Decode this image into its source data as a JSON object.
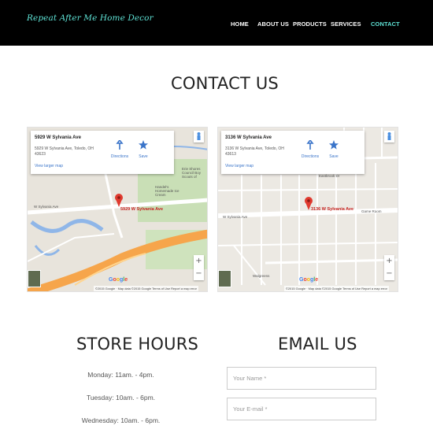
{
  "brand": "Repeat After Me Home Decor",
  "nav": [
    {
      "label": "HOME",
      "active": false
    },
    {
      "label": "ABOUT US",
      "active": false
    },
    {
      "label": "PRODUCTS",
      "active": false
    },
    {
      "label": "SERVICES",
      "active": false
    },
    {
      "label": "CONTACT",
      "active": true
    }
  ],
  "contact_title": "CONTACT US",
  "maps": [
    {
      "title": "5929 W Sylvania Ave",
      "address": "5929 W Sylvania Ave, Toledo, OH 43623",
      "link": "View larger map",
      "directions": "Directions",
      "save": "Save",
      "pin_label": "5929 W Sylvania Ave",
      "road": "W Sylvania Ave",
      "places": [
        "Handel's Homemade Ice Cream",
        "Erie Shores Council Boy Scouts of"
      ],
      "attribution": "©2015 Google · Map data ©2015 Google   Terms of Use   Report a map error"
    },
    {
      "title": "3136 W Sylvania Ave",
      "address": "3136 W Sylvania Ave, Toledo, OH 43613",
      "link": "View larger map",
      "directions": "Directions",
      "save": "Save",
      "pin_label": "3136 W Sylvania Ave",
      "road": "W Sylvania Ave",
      "places": [
        "Eastbrook Dr",
        "Game Room",
        "Walgreens"
      ],
      "attribution": "©2015 Google · Map data ©2015 Google   Terms of Use   Report a map error"
    }
  ],
  "store_hours_title": "STORE HOURS",
  "hours": [
    "Monday: 11am. - 4pm.",
    "Tuesday: 10am. - 6pm.",
    "Wednesday: 10am. - 6pm."
  ],
  "email_title": "EMAIL US",
  "form": {
    "name_placeholder": "Your Name *",
    "email_placeholder": "Your E-mail *"
  },
  "colors": {
    "accent": "#5fe3d6",
    "header_bg": "#000000",
    "link": "#3a74c9",
    "pin": "#c5221f"
  }
}
